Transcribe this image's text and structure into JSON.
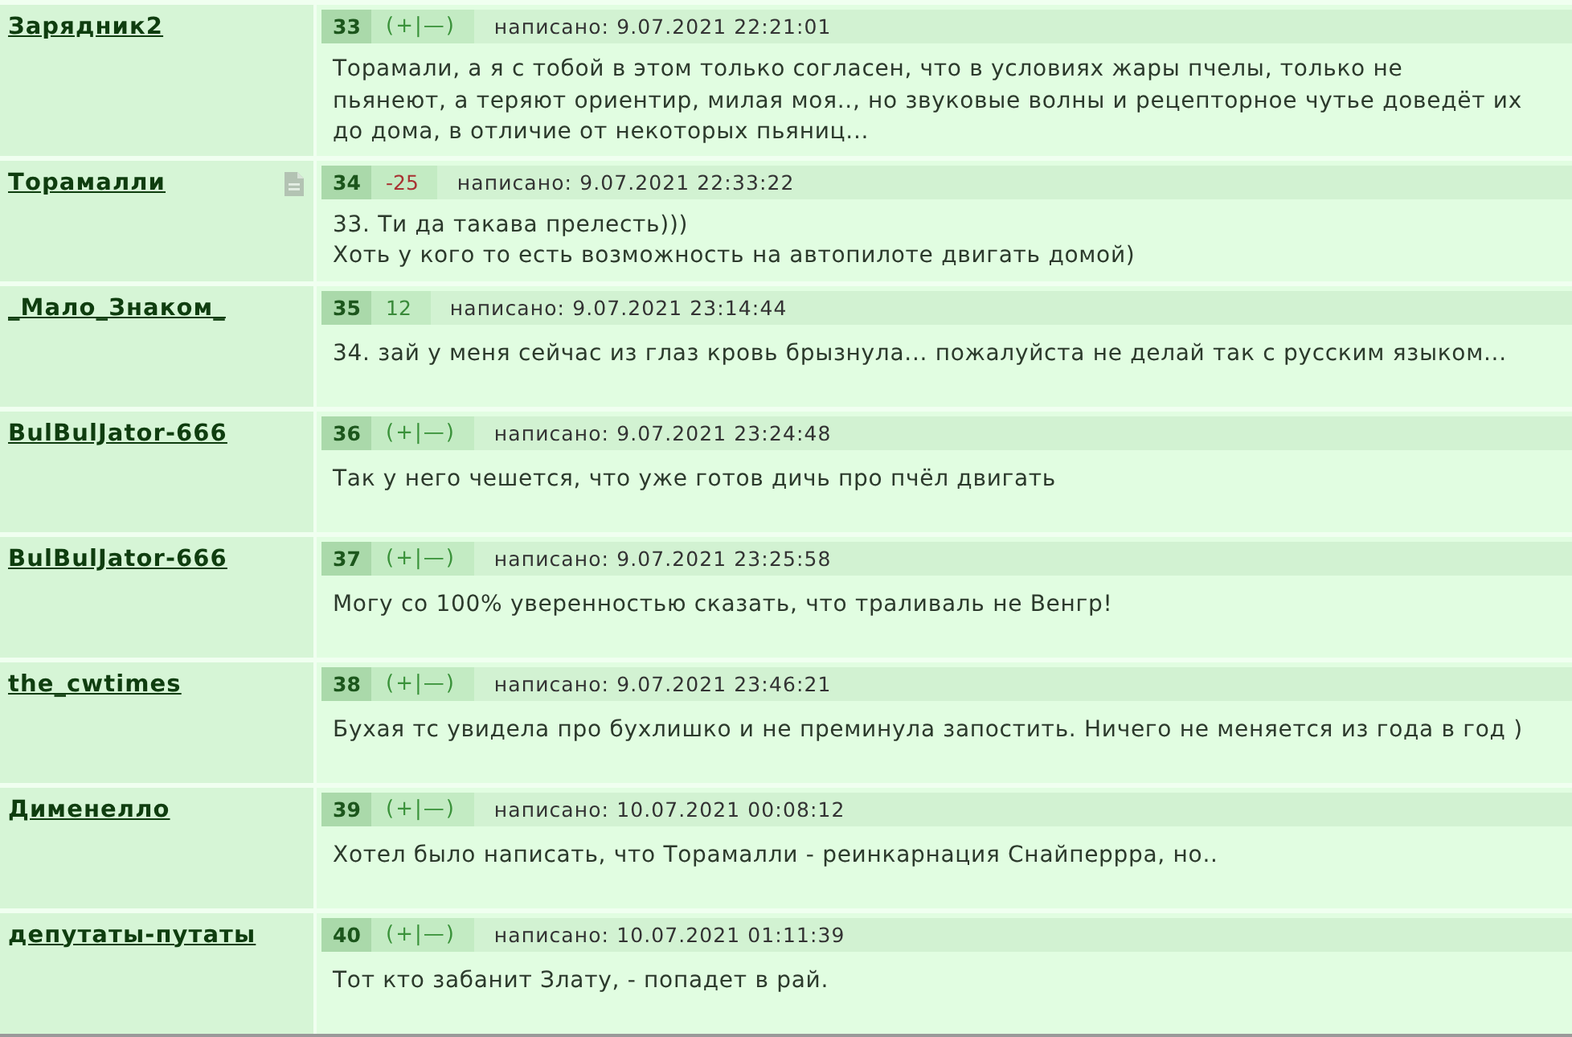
{
  "posts": [
    {
      "author": "Зарядник2",
      "note_icon": false,
      "number": "33",
      "rating": {
        "text": "(+|—)",
        "kind": "vote"
      },
      "date": "написано: 9.07.2021 22:21:01",
      "text": "Торамали, а я с тобой в этом только согласен, что в условиях жары пчелы, только не\nпьянеют, а теряют ориентир, милая моя.., но звуковые волны и рецепторное чутье доведёт их до дома, в отличие от некоторых пьяниц..."
    },
    {
      "author": "Торамалли",
      "note_icon": true,
      "number": "34",
      "rating": {
        "text": "-25",
        "kind": "negative"
      },
      "date": "написано: 9.07.2021 22:33:22",
      "text": "33. Ти да такава прелесть)))\nХоть у кого то есть возможность на автопилоте двигать домой)"
    },
    {
      "author": "_Мало_Знаком_",
      "note_icon": false,
      "number": "35",
      "rating": {
        "text": "12",
        "kind": "positive"
      },
      "date": "написано: 9.07.2021 23:14:44",
      "text": "34. зай у меня сейчас из глаз кровь брызнула... пожалуйста не делай так с русским языком..."
    },
    {
      "author": "BulBulJator-666",
      "note_icon": false,
      "number": "36",
      "rating": {
        "text": "(+|—)",
        "kind": "vote"
      },
      "date": "написано: 9.07.2021 23:24:48",
      "text": "Так у него чешется, что уже готов дичь про пчёл двигать"
    },
    {
      "author": "BulBulJator-666",
      "note_icon": false,
      "number": "37",
      "rating": {
        "text": "(+|—)",
        "kind": "vote"
      },
      "date": "написано: 9.07.2021 23:25:58",
      "text": "Могу со 100% уверенностью сказать, что траливаль не Венгр!"
    },
    {
      "author": "the_cwtimes",
      "note_icon": false,
      "number": "38",
      "rating": {
        "text": "(+|—)",
        "kind": "vote"
      },
      "date": "написано: 9.07.2021 23:46:21",
      "text": "Бухая тс увидела про бухлишко и не преминула запостить. Ничего не меняется из года в год )"
    },
    {
      "author": "Дименелло",
      "note_icon": false,
      "number": "39",
      "rating": {
        "text": "(+|—)",
        "kind": "vote"
      },
      "date": "написано: 10.07.2021 00:08:12",
      "text": "Хотел было написать, что Торамалли - реинкарнация Снайперрра, но.."
    },
    {
      "author": "депутаты-путаты",
      "note_icon": false,
      "number": "40",
      "rating": {
        "text": "(+|—)",
        "kind": "vote"
      },
      "date": "написано: 10.07.2021 01:11:39",
      "text": "Тот кто забанит Злату, - попадет в рай."
    }
  ]
}
